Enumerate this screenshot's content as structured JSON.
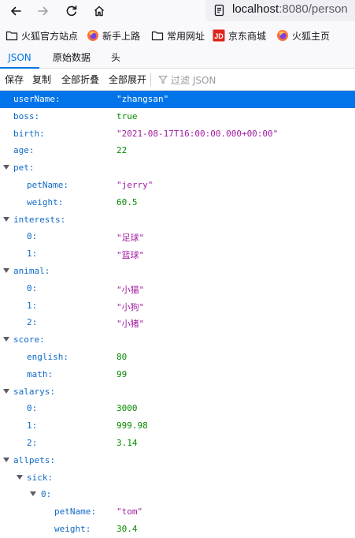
{
  "navbar": {
    "url_host": "localhost",
    "url_rest": ":8080/person"
  },
  "bookmarks": [
    {
      "label": "火狐官方站点",
      "icon": "folder-icon"
    },
    {
      "label": "新手上路",
      "icon": "firefox-icon"
    },
    {
      "label": "常用网址",
      "icon": "folder-icon"
    },
    {
      "label": "京东商城",
      "icon": "jd-icon"
    },
    {
      "label": "火狐主页",
      "icon": "firefox-icon"
    }
  ],
  "tabs": {
    "json": "JSON",
    "raw": "原始数据",
    "headers": "头"
  },
  "toolbar": {
    "save": "保存",
    "copy": "复制",
    "collapse_all": "全部折叠",
    "expand_all": "全部展开",
    "filter_placeholder": "过滤 JSON"
  },
  "rows": [
    {
      "key": "userName:",
      "value": "\"zhangsan\"",
      "type": "str",
      "depth": 0
    },
    {
      "key": "boss:",
      "value": "true",
      "type": "bool",
      "depth": 0
    },
    {
      "key": "birth:",
      "value": "\"2021-08-17T16:00:00.000+00:00\"",
      "type": "str",
      "depth": 0
    },
    {
      "key": "age:",
      "value": "22",
      "type": "num",
      "depth": 0
    },
    {
      "key": "pet:",
      "value": "",
      "type": "obj",
      "depth": 0
    },
    {
      "key": "petName:",
      "value": "\"jerry\"",
      "type": "str",
      "depth": 1
    },
    {
      "key": "weight:",
      "value": "60.5",
      "type": "num",
      "depth": 1
    },
    {
      "key": "interests:",
      "value": "",
      "type": "obj",
      "depth": 0
    },
    {
      "key": "0:",
      "value": "\"足球\"",
      "type": "str",
      "depth": 1
    },
    {
      "key": "1:",
      "value": "\"篮球\"",
      "type": "str",
      "depth": 1
    },
    {
      "key": "animal:",
      "value": "",
      "type": "obj",
      "depth": 0
    },
    {
      "key": "0:",
      "value": "\"小猫\"",
      "type": "str",
      "depth": 1
    },
    {
      "key": "1:",
      "value": "\"小狗\"",
      "type": "str",
      "depth": 1
    },
    {
      "key": "2:",
      "value": "\"小猪\"",
      "type": "str",
      "depth": 1
    },
    {
      "key": "score:",
      "value": "",
      "type": "obj",
      "depth": 0
    },
    {
      "key": "english:",
      "value": "80",
      "type": "num",
      "depth": 1
    },
    {
      "key": "math:",
      "value": "99",
      "type": "num",
      "depth": 1
    },
    {
      "key": "salarys:",
      "value": "",
      "type": "obj",
      "depth": 0
    },
    {
      "key": "0:",
      "value": "3000",
      "type": "num",
      "depth": 1
    },
    {
      "key": "1:",
      "value": "999.98",
      "type": "num",
      "depth": 1
    },
    {
      "key": "2:",
      "value": "3.14",
      "type": "num",
      "depth": 1
    },
    {
      "key": "allpets:",
      "value": "",
      "type": "obj",
      "depth": 0
    },
    {
      "key": "sick:",
      "value": "",
      "type": "obj",
      "depth": 1
    },
    {
      "key": "0:",
      "value": "",
      "type": "obj",
      "depth": 2
    },
    {
      "key": "petName:",
      "value": "\"tom\"",
      "type": "str",
      "depth": 3
    },
    {
      "key": "weight:",
      "value": "30.4",
      "type": "num",
      "depth": 3
    }
  ]
}
